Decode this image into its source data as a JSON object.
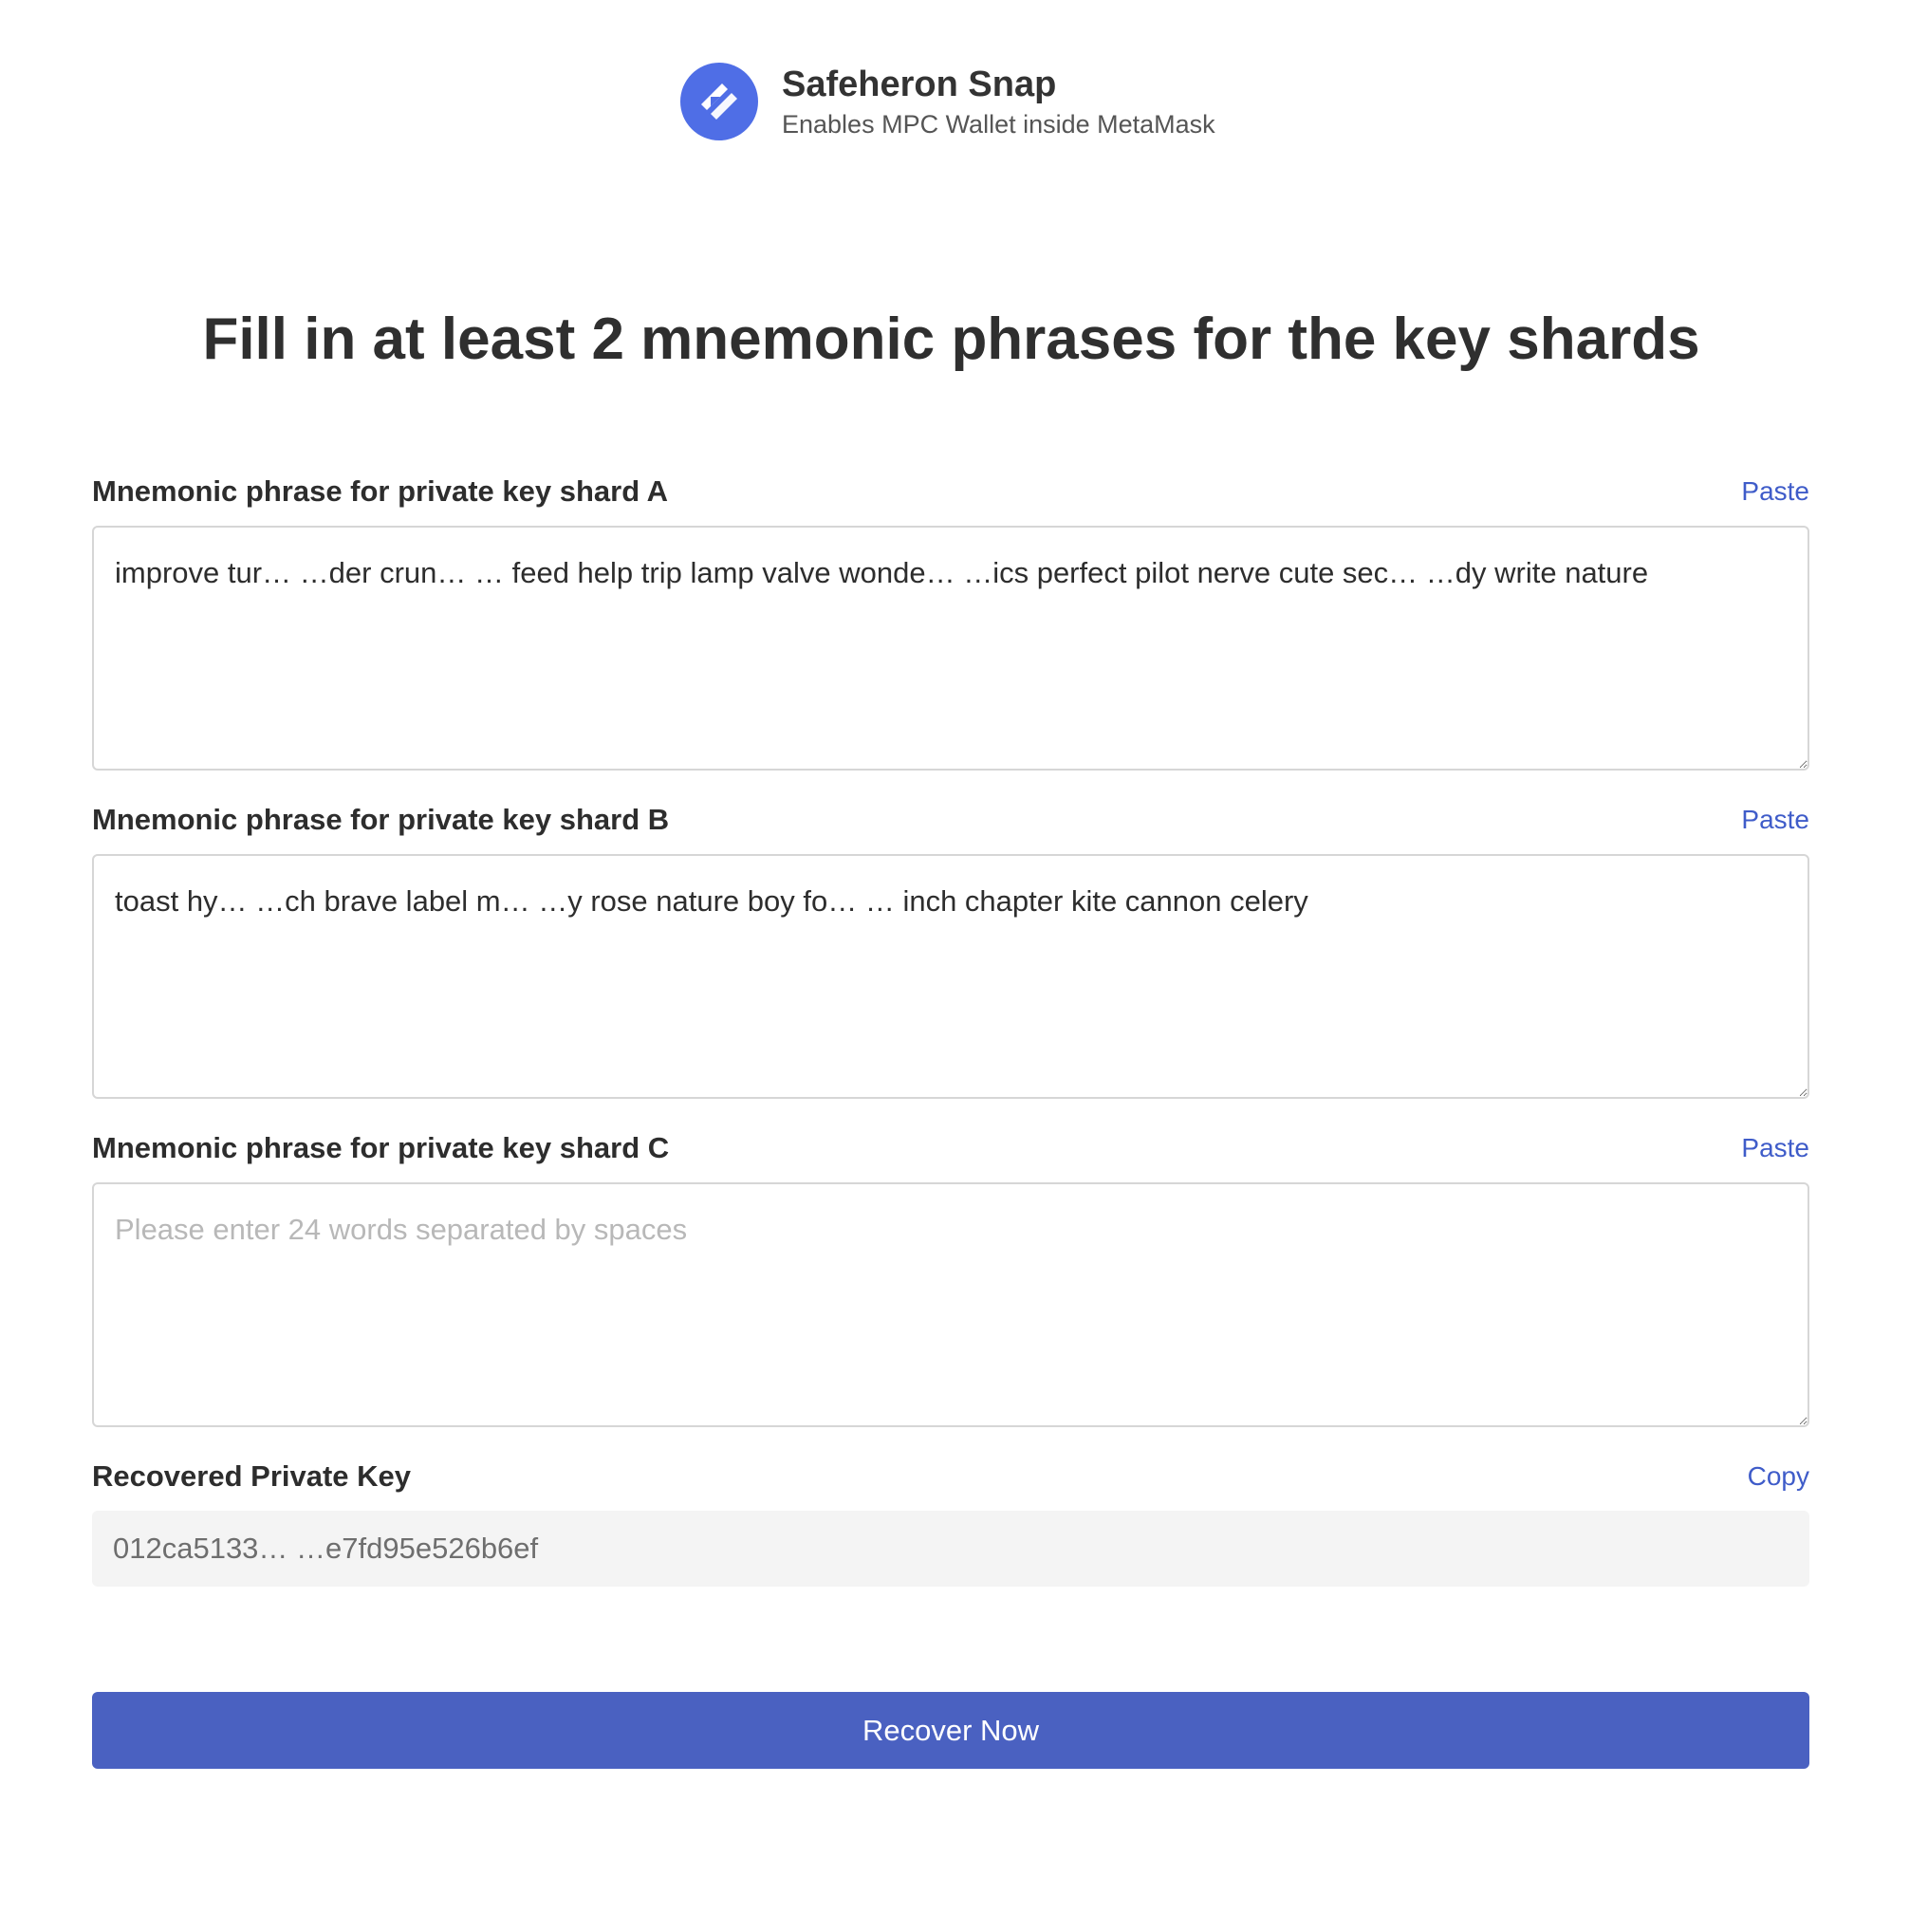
{
  "header": {
    "brand_name": "Safeheron Snap",
    "tagline": "Enables MPC Wallet inside MetaMask",
    "logo_icon": "safeheron-logo-icon",
    "logo_color": "#4f6ee6"
  },
  "title": "Fill in at least 2 mnemonic phrases for the key shards",
  "shards": [
    {
      "label": "Mnemonic phrase for private key shard A",
      "action": "Paste",
      "value": "improve tur… …der crun… … feed help trip lamp valve wonde… …ics perfect pilot nerve cute sec… …dy write nature",
      "placeholder": "Please enter 24 words separated by spaces"
    },
    {
      "label": "Mnemonic phrase for private key shard B",
      "action": "Paste",
      "value": "toast hy… …ch brave label m… …y rose nature boy fo… … inch chapter kite cannon celery",
      "placeholder": "Please enter 24 words separated by spaces"
    },
    {
      "label": "Mnemonic phrase for private key shard C",
      "action": "Paste",
      "value": "",
      "placeholder": "Please enter 24 words separated by spaces"
    }
  ],
  "recovered": {
    "label": "Recovered Private Key",
    "action": "Copy",
    "value": "012ca5133… …e7fd95e526b6ef"
  },
  "recover_button": "Recover Now",
  "colors": {
    "accent": "#3f5cc9",
    "button": "#4a61c1"
  }
}
